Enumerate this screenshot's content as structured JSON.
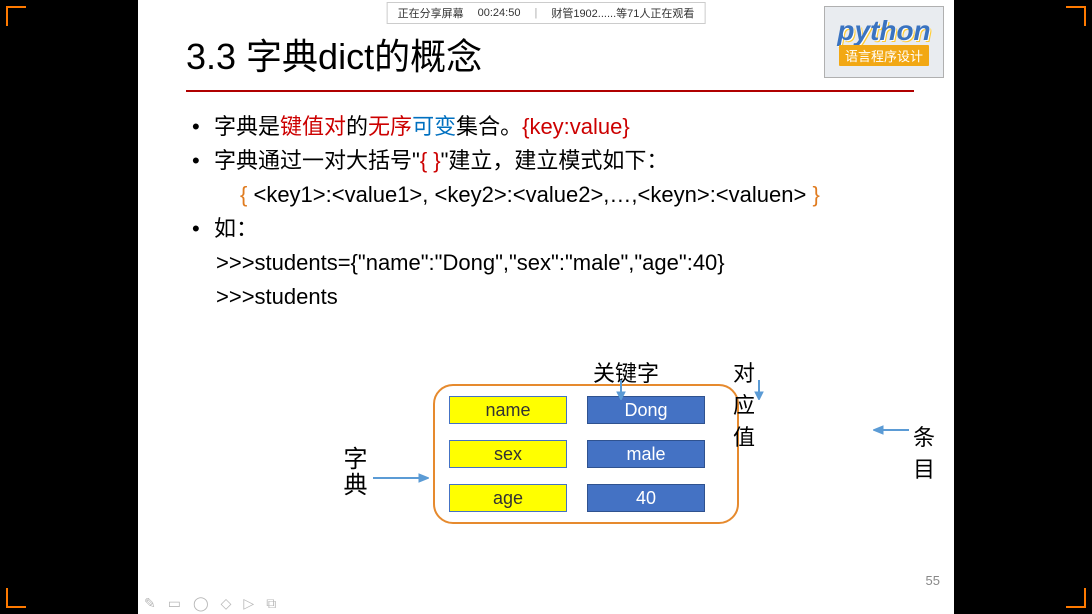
{
  "topbar": {
    "sharing": "正在分享屏幕",
    "time": "00:24:50",
    "viewers": "财管1902......等71人正在观看"
  },
  "logo": {
    "main": "python",
    "sub": "语言程序设计"
  },
  "title": "3.3 字典dict的概念",
  "bullet1": {
    "a": "字典是",
    "b": "键值对",
    "c": "的",
    "d": "无序",
    "e": "可变",
    "f": "集合。",
    "g": "{key:value}"
  },
  "bullet2": {
    "a": "字典通过一对大括号\"",
    "b": "{  }",
    "c": "\"建立，建立模式如下："
  },
  "syntax": {
    "open": "{ ",
    "body": "<key1>:<value1>, <key2>:<value2>,…,<keyn>:<valuen>",
    "close": " }"
  },
  "bullet3": "如：",
  "code1": ">>>students={\"name\":\"Dong\",\"sex\":\"male\",\"age\":40}",
  "code2": ">>>students",
  "diagram": {
    "keyword_label": "关键字",
    "value_label": "对应值",
    "entry_label": "条目",
    "dict_label": "字典",
    "rows": [
      {
        "key": "name",
        "val": "Dong"
      },
      {
        "key": "sex",
        "val": "male"
      },
      {
        "key": "age",
        "val": "40"
      }
    ]
  },
  "page": "55"
}
